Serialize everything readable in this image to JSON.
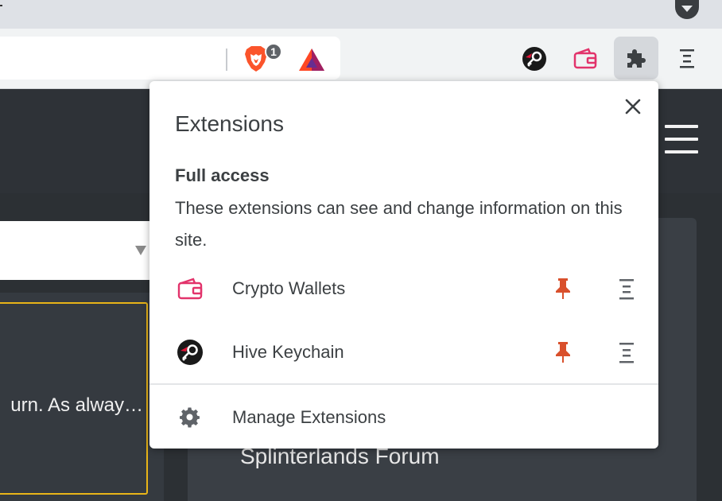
{
  "browser": {
    "brave_shield_count": "1",
    "icons": [
      "brave-lion-icon",
      "bat-rewards-icon",
      "hive-keychain-icon",
      "crypto-wallets-icon",
      "extensions-puzzle-icon",
      "kebab-menu-icon"
    ]
  },
  "popup": {
    "title": "Extensions",
    "section_title": "Full access",
    "section_desc": "These extensions can see and change information on this site.",
    "extensions": [
      {
        "name": "Crypto Wallets",
        "icon": "crypto-wallets-icon",
        "pinned": true
      },
      {
        "name": "Hive Keychain",
        "icon": "hive-keychain-icon",
        "pinned": true
      }
    ],
    "manage_label": "Manage Extensions"
  },
  "page": {
    "snippet_text": "urn. As alway…",
    "forum_title": "Splinterlands Forum"
  },
  "colors": {
    "accent_pin": "#d9502c",
    "wallet_pink": "#e2336b",
    "hive_red": "#e31337",
    "gold_border": "#e8b418"
  }
}
